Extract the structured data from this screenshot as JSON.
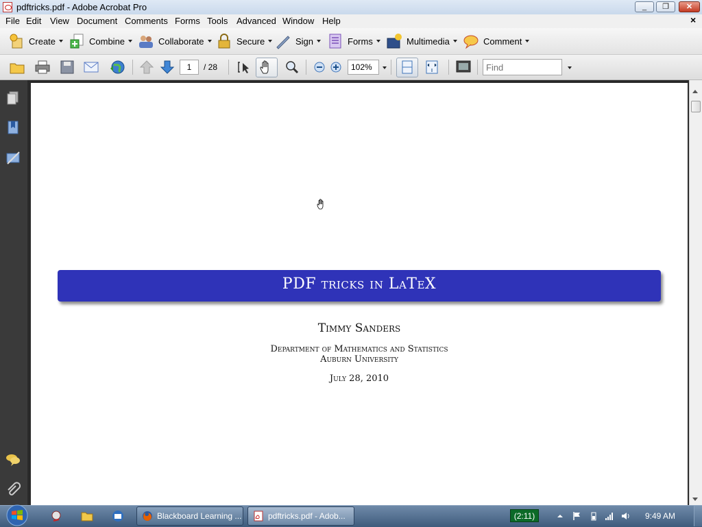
{
  "window": {
    "title": "pdftricks.pdf - Adobe Acrobat Pro",
    "min_label": "_",
    "max_label": "❐",
    "close_label": "✕"
  },
  "menu": {
    "items": [
      "File",
      "Edit",
      "View",
      "Document",
      "Comments",
      "Forms",
      "Tools",
      "Advanced",
      "Window",
      "Help"
    ],
    "close": "×"
  },
  "tasks": {
    "items": [
      "Create",
      "Combine",
      "Collaborate",
      "Secure",
      "Sign",
      "Forms",
      "Multimedia",
      "Comment"
    ]
  },
  "quickbar": {
    "page_current": "1",
    "page_total": "/ 28",
    "zoom": "102%",
    "find_placeholder": "Find"
  },
  "document": {
    "title": "PDF tricks in LaTeX",
    "author": "Timmy Sanders",
    "department": "Department of Mathematics and Statistics",
    "university": "Auburn University",
    "date": "July 28, 2010"
  },
  "taskbar": {
    "buttons": [
      "Blackboard Learning ...",
      "pdftricks.pdf - Adob..."
    ],
    "battery": "(2:11)",
    "clock": "9:49 AM"
  },
  "colors": {
    "banner": "#2f33b8",
    "page": "#ffffff",
    "nav": "#3a3a3a"
  }
}
